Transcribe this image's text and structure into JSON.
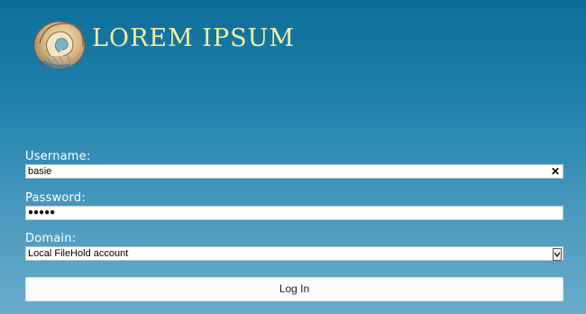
{
  "brand": {
    "name": "LOREM IPSUM",
    "logo_icon": "nautilus-shell-icon"
  },
  "form": {
    "username_label": "Username:",
    "username_value": "basie",
    "password_label": "Password:",
    "password_mask": "●●●●●",
    "domain_label": "Domain:",
    "domain_value": "Local FileHold account",
    "login_label": "Log In"
  },
  "colors": {
    "background_top": "#0b6e99",
    "background_bottom": "#6aaccb",
    "brand_text": "#f4eda0"
  }
}
